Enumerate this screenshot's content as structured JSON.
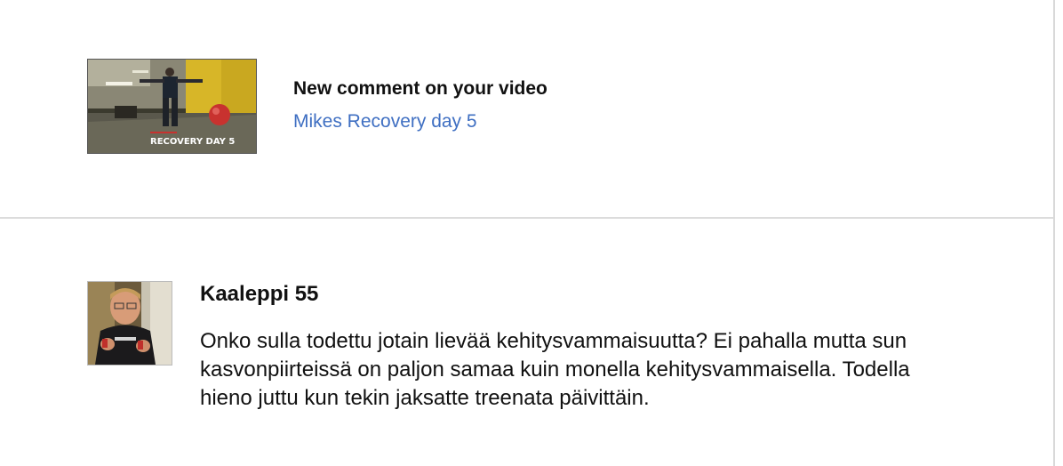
{
  "notification": {
    "title": "New comment on your video",
    "video_title": "Mikes Recovery day 5",
    "thumbnail_overlay": "RECOVERY DAY 5"
  },
  "comment": {
    "author": "Kaaleppi 55",
    "text": "Onko sulla todettu jotain lievää kehitysvammaisuutta? Ei pahalla mutta sun kasvonpiirteissä on paljon samaa kuin monella kehitysvammaisella. Todella hieno juttu kun tekin jaksatte treenata päivittäin."
  },
  "colors": {
    "link": "#3f6fc2",
    "text": "#111111",
    "divider": "#dcdcdc"
  }
}
